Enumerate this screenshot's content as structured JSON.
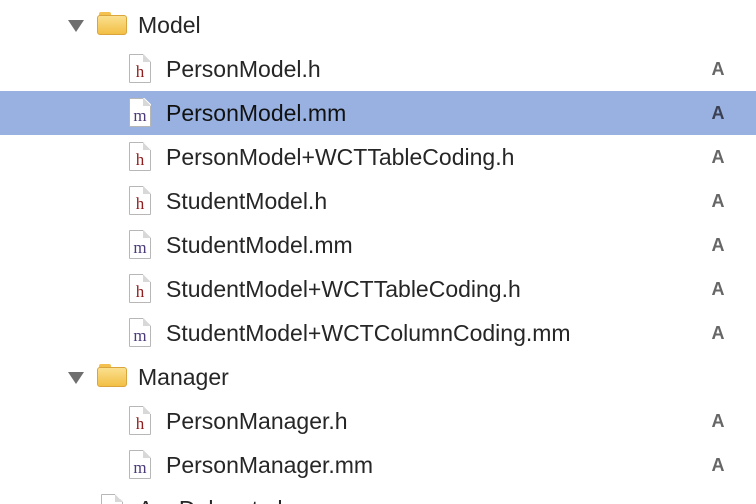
{
  "navigator": {
    "groups": [
      {
        "name": "Model",
        "expanded": true,
        "icon": "folder-icon",
        "files": [
          {
            "name": "PersonModel.h",
            "glyph": "h",
            "kind": "header",
            "status": "A",
            "selected": false
          },
          {
            "name": "PersonModel.mm",
            "glyph": "m",
            "kind": "implementation",
            "status": "A",
            "selected": true
          },
          {
            "name": "PersonModel+WCTTableCoding.h",
            "glyph": "h",
            "kind": "header",
            "status": "A",
            "selected": false
          },
          {
            "name": "StudentModel.h",
            "glyph": "h",
            "kind": "header",
            "status": "A",
            "selected": false
          },
          {
            "name": "StudentModel.mm",
            "glyph": "m",
            "kind": "implementation",
            "status": "A",
            "selected": false
          },
          {
            "name": "StudentModel+WCTTableCoding.h",
            "glyph": "h",
            "kind": "header",
            "status": "A",
            "selected": false
          },
          {
            "name": "StudentModel+WCTColumnCoding.mm",
            "glyph": "m",
            "kind": "implementation",
            "status": "A",
            "selected": false
          }
        ]
      },
      {
        "name": "Manager",
        "expanded": true,
        "icon": "folder-icon",
        "files": [
          {
            "name": "PersonManager.h",
            "glyph": "h",
            "kind": "header",
            "status": "A",
            "selected": false
          },
          {
            "name": "PersonManager.mm",
            "glyph": "m",
            "kind": "implementation",
            "status": "A",
            "selected": false
          }
        ]
      }
    ],
    "partial_item": {
      "name": "AppDelegate.h",
      "glyph": "h",
      "kind": "header"
    }
  },
  "colors": {
    "selection": "#98b1e0",
    "header_glyph": "#8f1d1d",
    "implementation_glyph": "#4b3c78",
    "folder": "#f4c14e",
    "status_text": "#666666"
  }
}
